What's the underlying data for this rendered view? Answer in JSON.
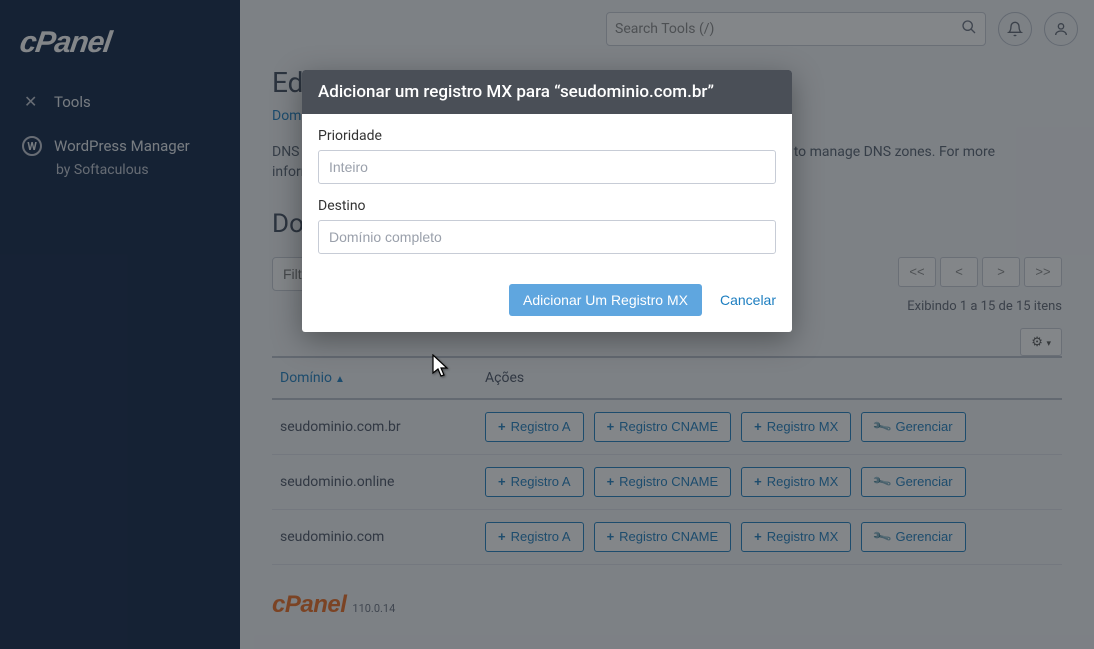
{
  "sidebar": {
    "logo_text": "cPanel",
    "items": [
      {
        "icon": "tools-icon",
        "label": "Tools"
      },
      {
        "icon": "wordpress-icon",
        "label": "WordPress Manager"
      }
    ],
    "sub_label": "by Softaculous"
  },
  "header": {
    "search_placeholder": "Search Tools (/)"
  },
  "page": {
    "title": "Editor de zona",
    "breadcrumb": "Domínios",
    "description": "DNS converts domain names into computer-readable IP addresses. Use this feature to manage DNS zones. For more information, read the documentation.",
    "section_title": "Domínios",
    "filter_placeholder": "Filtrar por domínio",
    "count_text": "Exibindo 1 a 15 de 15 itens",
    "pager": {
      "first": "<<",
      "prev": "<",
      "next": ">",
      "last": ">>"
    },
    "columns": {
      "domain": "Domínio",
      "actions": "Ações"
    },
    "action_labels": {
      "a": "Registro A",
      "cname": "Registro CNAME",
      "mx": "Registro MX",
      "manage": "Gerenciar"
    },
    "rows": [
      {
        "domain": "seudominio.com.br"
      },
      {
        "domain": "seudominio.online"
      },
      {
        "domain": "seudominio.com"
      }
    ]
  },
  "footer": {
    "brand": "cPanel",
    "version": "110.0.14"
  },
  "modal": {
    "title": "Adicionar um registro MX para “seudominio.com.br”",
    "fields": {
      "priority_label": "Prioridade",
      "priority_placeholder": "Inteiro",
      "destination_label": "Destino",
      "destination_placeholder": "Domínio completo"
    },
    "buttons": {
      "submit": "Adicionar Um Registro MX",
      "cancel": "Cancelar"
    }
  }
}
